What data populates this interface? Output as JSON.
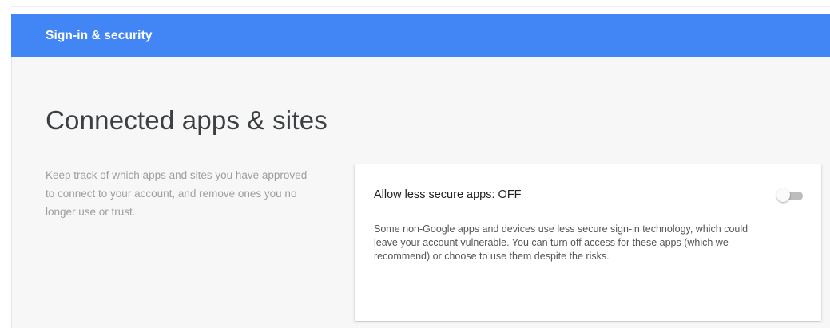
{
  "header": {
    "title": "Sign-in & security",
    "color": "#4285f4"
  },
  "section": {
    "title": "Connected apps & sites",
    "description": "Keep track of which apps and sites you have approved to connect to your account, and remove ones you no longer use or trust."
  },
  "card": {
    "title": "Allow less secure apps: OFF",
    "body": "Some non-Google apps and devices use less secure sign-in technology, which could leave your account vulnerable. You can turn off access for these apps (which we recommend) or choose to use them despite the risks.",
    "toggle": {
      "state": "off",
      "icon": "toggle-switch-icon"
    }
  }
}
